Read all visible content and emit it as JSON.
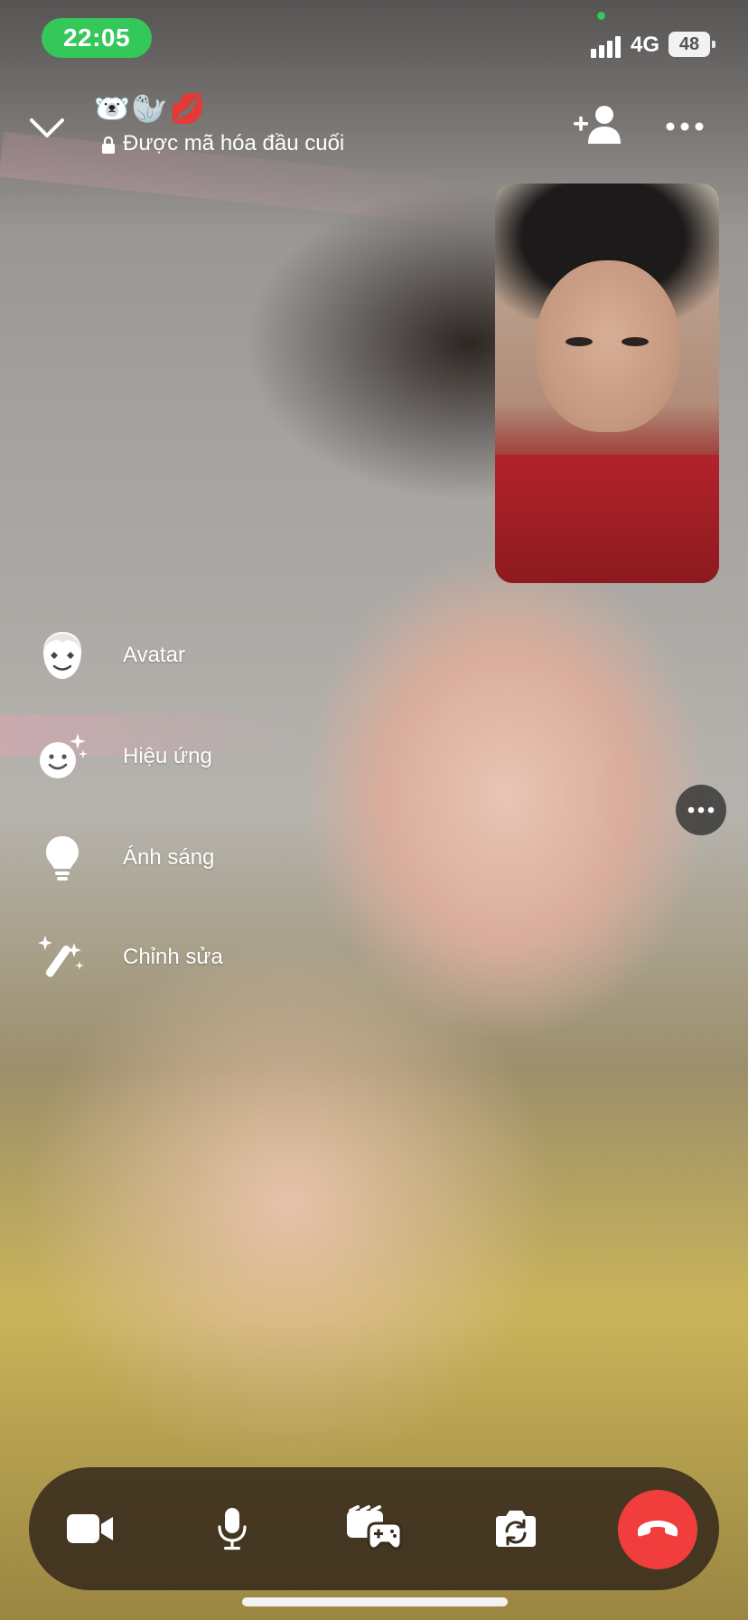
{
  "status_bar": {
    "time": "22:05",
    "network": "4G",
    "battery": "48"
  },
  "header": {
    "collapse_icon": "chevron-down-icon",
    "title_emojis": "🐻‍❄️🦭💋",
    "encryption_text": "Được mã hóa đầu cuối",
    "add_person_icon": "add-person-icon",
    "more_icon": "more-horizontal-icon"
  },
  "effects_menu": [
    {
      "label": "Avatar",
      "icon": "avatar-face-icon"
    },
    {
      "label": "Hiệu ứng",
      "icon": "smiley-sparkle-icon"
    },
    {
      "label": "Ánh sáng",
      "icon": "lightbulb-icon"
    },
    {
      "label": "Chỉnh sửa",
      "icon": "magic-wand-icon"
    }
  ],
  "controls": [
    {
      "name": "camera",
      "icon": "video-camera-icon"
    },
    {
      "name": "microphone",
      "icon": "microphone-icon"
    },
    {
      "name": "activities",
      "icon": "games-activities-icon"
    },
    {
      "name": "flip-camera",
      "icon": "flip-camera-icon"
    },
    {
      "name": "end-call",
      "icon": "end-call-icon"
    }
  ],
  "colors": {
    "status_time_bg": "#34c759",
    "end_call": "#f23d3d",
    "control_bar": "#372a1c"
  }
}
